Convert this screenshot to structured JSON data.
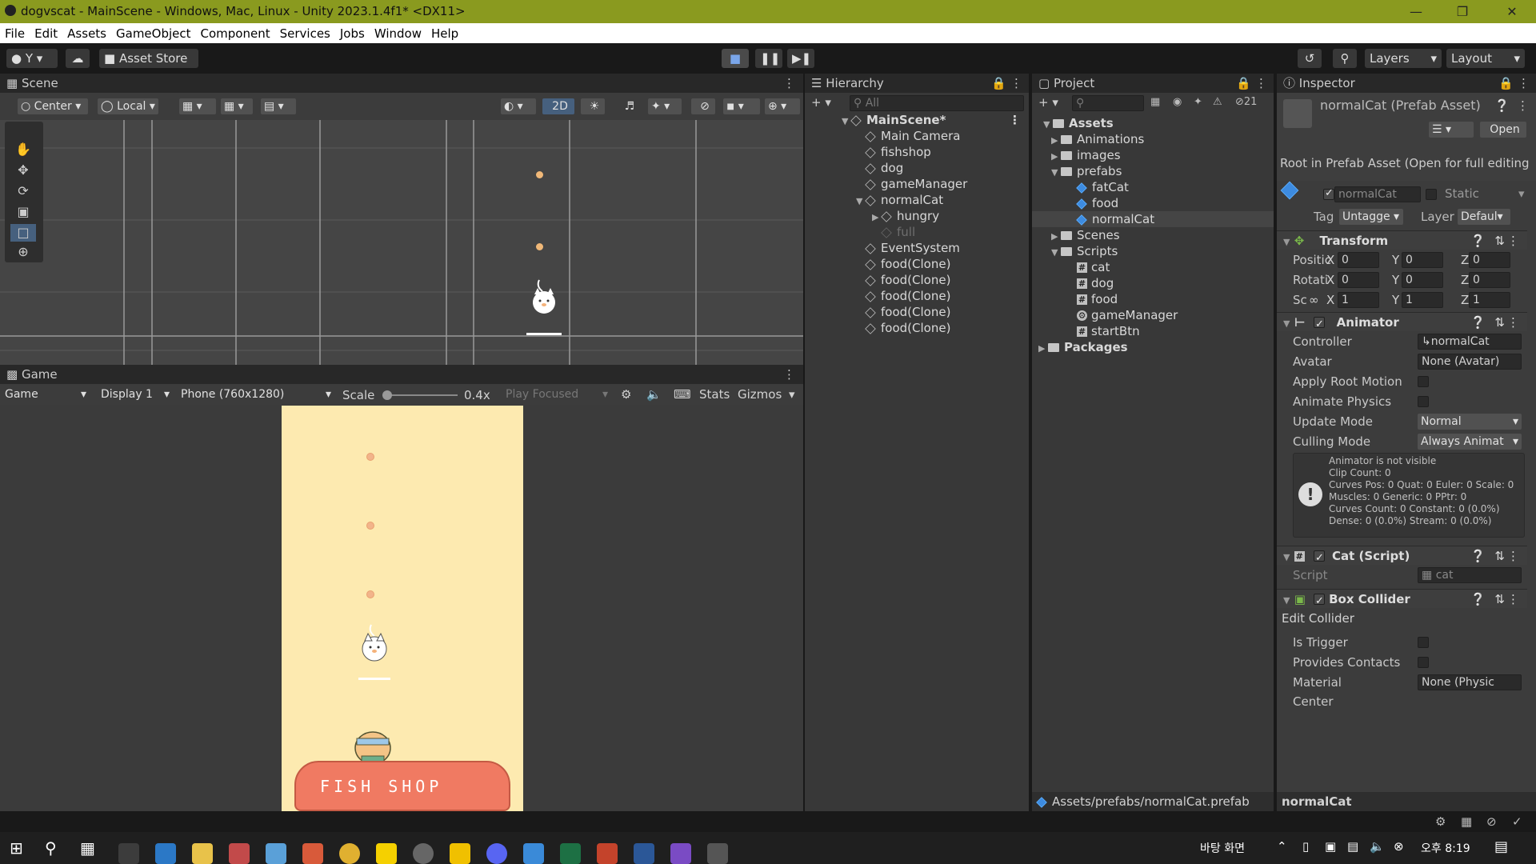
{
  "window": {
    "title": "dogvscat - MainScene - Windows, Mac, Linux - Unity 2023.1.4f1* <DX11>"
  },
  "menu": [
    "File",
    "Edit",
    "Assets",
    "GameObject",
    "Component",
    "Services",
    "Jobs",
    "Window",
    "Help"
  ],
  "toolbar": {
    "account": "Y",
    "asset_store": "Asset Store",
    "layers": "Layers",
    "layout": "Layout"
  },
  "scene": {
    "tab": "Scene",
    "pivot": "Center",
    "space": "Local",
    "mode2d": "2D"
  },
  "game": {
    "tab": "Game",
    "view": "Game",
    "display": "Display 1",
    "resolution": "Phone (760x1280)",
    "scale_label": "Scale",
    "scale_value": "0.4x",
    "play_focused": "Play Focused",
    "stats": "Stats",
    "gizmos": "Gizmos",
    "shop_text": "FISH SHOP",
    "scale_level": 0.4
  },
  "hierarchy": {
    "tab": "Hierarchy",
    "search_placeholder": "All",
    "scene": "MainScene*",
    "items": [
      "Main Camera",
      "fishshop",
      "dog",
      "gameManager",
      "normalCat",
      "hungry",
      "full",
      "EventSystem",
      "food(Clone)",
      "food(Clone)",
      "food(Clone)",
      "food(Clone)",
      "food(Clone)"
    ]
  },
  "project": {
    "tab": "Project",
    "hidden_count": "21",
    "assets": "Assets",
    "folders": [
      "Animations",
      "images",
      "prefabs",
      "Scenes",
      "Scripts",
      "Packages"
    ],
    "prefabs": [
      "fatCat",
      "food",
      "normalCat"
    ],
    "scripts": [
      "cat",
      "dog",
      "food",
      "gameManager",
      "startBtn"
    ],
    "path": "Assets/prefabs/normalCat.prefab"
  },
  "inspector": {
    "tab": "Inspector",
    "asset_title": "normalCat (Prefab Asset)",
    "open": "Open",
    "root_msg": "Root in Prefab Asset (Open for full editing",
    "name": "normalCat",
    "static": "Static",
    "tag_label": "Tag",
    "tag": "Untagge",
    "layer_label": "Layer",
    "layer": "Defaul",
    "transform": {
      "title": "Transform",
      "position": "Positic",
      "rotation": "Rotati",
      "scale": "Sc",
      "x": "X",
      "y": "Y",
      "z": "Z",
      "pos": [
        "0",
        "0",
        "0"
      ],
      "rot": [
        "0",
        "0",
        "0"
      ],
      "scl": [
        "1",
        "1",
        "1"
      ]
    },
    "animator": {
      "title": "Animator",
      "controller_label": "Controller",
      "controller": "normalCat",
      "avatar_label": "Avatar",
      "avatar": "None (Avatar)",
      "apply_root": "Apply Root Motion",
      "animate_physics": "Animate Physics",
      "update_mode_label": "Update Mode",
      "update_mode": "Normal",
      "culling_label": "Culling Mode",
      "culling": "Always Animat",
      "info": [
        "Animator is not visible",
        "Clip Count: 0",
        "Curves Pos: 0 Quat: 0 Euler: 0 Scale: 0",
        "Muscles: 0 Generic: 0 PPtr: 0",
        "Curves Count: 0 Constant: 0 (0.0%)",
        "Dense: 0 (0.0%) Stream: 0 (0.0%)"
      ]
    },
    "cat_script": {
      "title": "Cat (Script)",
      "script_label": "Script",
      "script": "cat"
    },
    "box_collider": {
      "title": "Box Collider",
      "edit": "Edit Collider",
      "is_trigger": "Is Trigger",
      "provides": "Provides Contacts",
      "material_label": "Material",
      "material": "None (Physic",
      "center": "Center"
    },
    "footer": "normalCat"
  },
  "taskbar": {
    "desktop": "바탕 화면",
    "time": "오후 8:19"
  },
  "colors": {
    "titlebar": "#8a9a1f",
    "game_bg": "#fdeab0",
    "shop": "#f07a62",
    "food": "#f2b48a"
  }
}
